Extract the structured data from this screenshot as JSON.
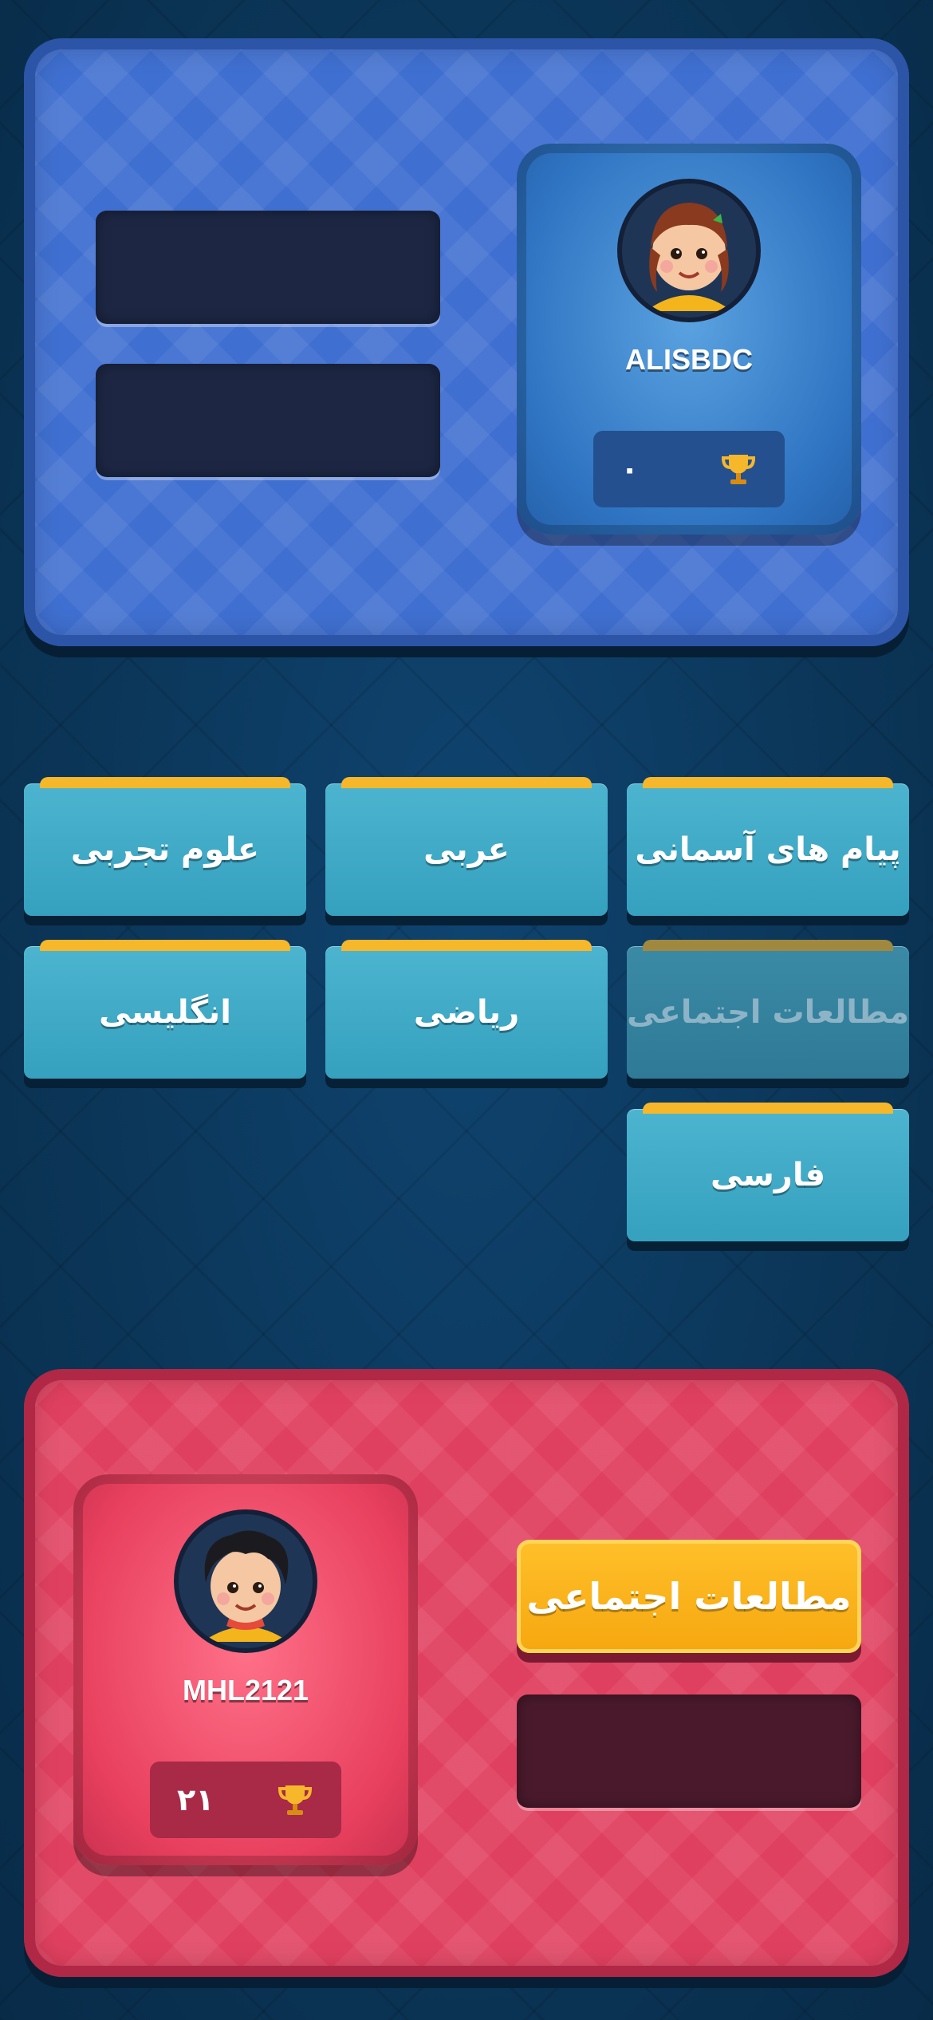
{
  "opponent": {
    "name": "ALISBDC",
    "score": "۰",
    "avatar_icon": "girl-avatar-icon"
  },
  "player": {
    "name": "MHL2121",
    "score": "۲۱",
    "avatar_icon": "boy-avatar-icon",
    "selected_subject": "مطالعات اجتماعی"
  },
  "subjects": [
    {
      "label": "پیام های آسمانی",
      "enabled": true
    },
    {
      "label": "عربی",
      "enabled": true
    },
    {
      "label": "علوم تجربی",
      "enabled": true
    },
    {
      "label": "مطالعات اجتماعی",
      "enabled": false
    },
    {
      "label": "ریاضی",
      "enabled": true
    },
    {
      "label": "انگلیسی",
      "enabled": true
    },
    {
      "label": "فارسی",
      "enabled": true
    }
  ],
  "colors": {
    "opponent_panel": "#3f6fd0",
    "player_panel": "#e0405f",
    "subject_tile": "#43aec9",
    "subject_tab": "#f7b72a",
    "selected_subject": "#fbb31c"
  }
}
